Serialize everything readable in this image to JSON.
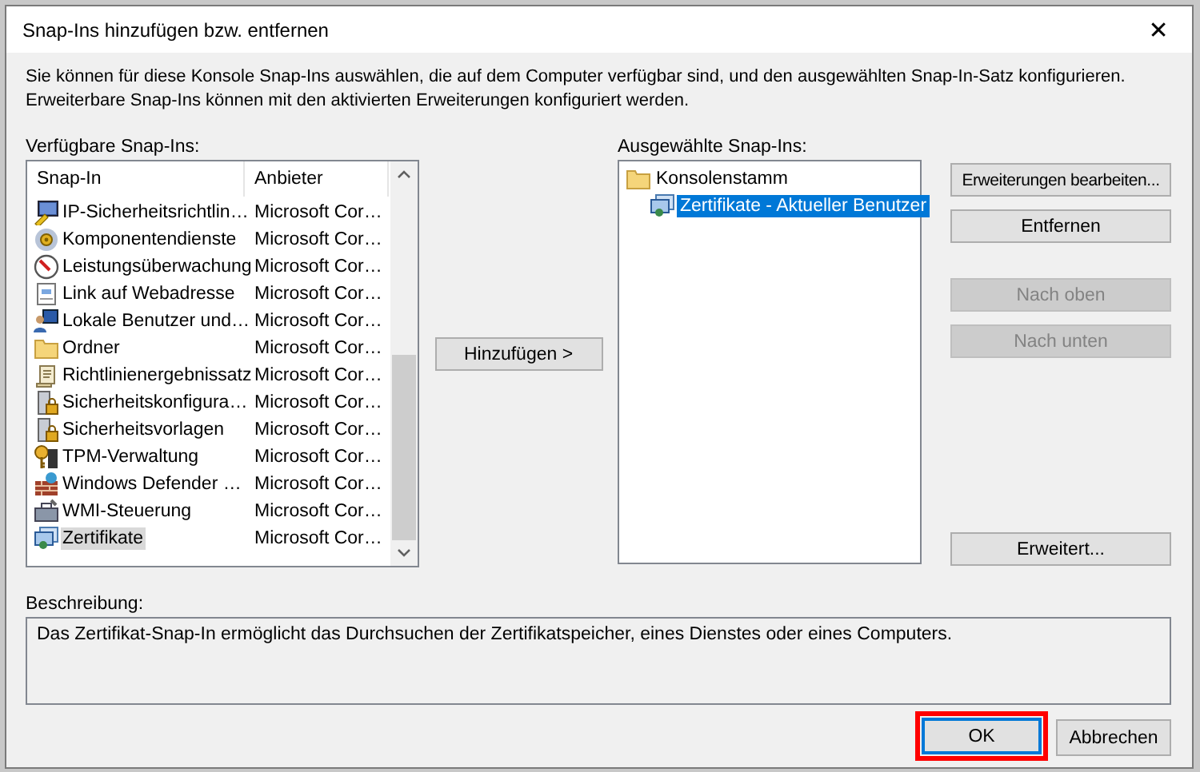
{
  "window": {
    "title": "Snap-Ins hinzufügen bzw. entfernen",
    "close": "✕"
  },
  "intro": "Sie können für diese Konsole Snap-Ins auswählen, die auf dem Computer verfügbar sind, und den ausgewählten Snap-In-Satz konfigurieren. Erweiterbare Snap-Ins können mit den aktivierten Erweiterungen konfiguriert werden.",
  "available": {
    "label": "Verfügbare Snap-Ins:",
    "columns": [
      "Snap-In",
      "Anbieter"
    ],
    "rows": [
      {
        "name": "IP-Sicherheitsrichtlin…",
        "vendor": "Microsoft Cor…",
        "selected": false
      },
      {
        "name": "Komponentendienste",
        "vendor": "Microsoft Cor…",
        "selected": false
      },
      {
        "name": "Leistungsüberwachung",
        "vendor": "Microsoft Cor…",
        "selected": false
      },
      {
        "name": "Link auf Webadresse",
        "vendor": "Microsoft Cor…",
        "selected": false
      },
      {
        "name": "Lokale Benutzer und…",
        "vendor": "Microsoft Cor…",
        "selected": false
      },
      {
        "name": "Ordner",
        "vendor": "Microsoft Cor…",
        "selected": false
      },
      {
        "name": "Richtlinienergebnissatz",
        "vendor": "Microsoft Cor…",
        "selected": false
      },
      {
        "name": "Sicherheitskonfigura…",
        "vendor": "Microsoft Cor…",
        "selected": false
      },
      {
        "name": "Sicherheitsvorlagen",
        "vendor": "Microsoft Cor…",
        "selected": false
      },
      {
        "name": "TPM-Verwaltung",
        "vendor": "Microsoft Cor…",
        "selected": false
      },
      {
        "name": "Windows Defender …",
        "vendor": "Microsoft Cor…",
        "selected": false
      },
      {
        "name": "WMI-Steuerung",
        "vendor": "Microsoft Cor…",
        "selected": false
      },
      {
        "name": "Zertifikate",
        "vendor": "Microsoft Cor…",
        "selected": true
      }
    ]
  },
  "add_button": {
    "label": "Hinzufügen >",
    "disabled": false
  },
  "selected_snapins": {
    "label": "Ausgewählte Snap-Ins:",
    "tree": [
      {
        "label": "Konsolenstamm",
        "selected": false,
        "children": [
          {
            "label": "Zertifikate - Aktueller Benutzer",
            "selected": true
          }
        ]
      }
    ]
  },
  "side_buttons": [
    {
      "label": "Erweiterungen bearbeiten...",
      "disabled": false
    },
    {
      "label": "Entfernen",
      "disabled": false
    },
    {
      "label": "Nach oben",
      "disabled": true
    },
    {
      "label": "Nach unten",
      "disabled": true
    },
    {
      "label": "Erweitert...",
      "disabled": false
    }
  ],
  "description": {
    "label": "Beschreibung:",
    "text": "Das Zertifikat-Snap-In ermöglicht das Durchsuchen der Zertifikatspeicher, eines Dienstes oder eines Computers."
  },
  "footer_buttons": [
    {
      "label": "OK",
      "default": true,
      "highlighted": true
    },
    {
      "label": "Abbrechen",
      "default": false,
      "highlighted": false
    }
  ]
}
